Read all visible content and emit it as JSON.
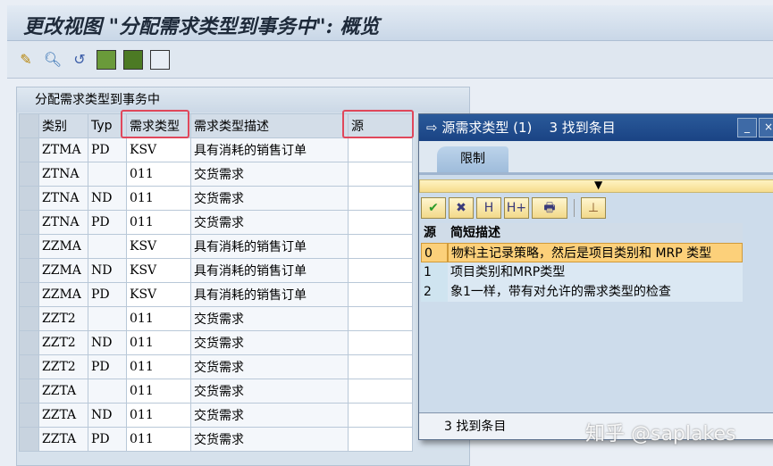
{
  "title": "更改视图 \"分配需求类型到事务中\": 概览",
  "toolbar": {
    "icons": [
      "change-display-icon",
      "find-icon",
      "undo-icon",
      "select-all-icon",
      "select-block-icon",
      "deselect-all-icon"
    ]
  },
  "panel": {
    "title": "分配需求类型到事务中",
    "columns": [
      "类别",
      "Typ",
      "需求类型",
      "需求类型描述",
      "源"
    ],
    "rows": [
      [
        "ZTMA",
        "PD",
        "KSV",
        "具有消耗的销售订单",
        ""
      ],
      [
        "ZTNA",
        "",
        "011",
        "交货需求",
        ""
      ],
      [
        "ZTNA",
        "ND",
        "011",
        "交货需求",
        ""
      ],
      [
        "ZTNA",
        "PD",
        "011",
        "交货需求",
        ""
      ],
      [
        "ZZMA",
        "",
        "KSV",
        "具有消耗的销售订单",
        ""
      ],
      [
        "ZZMA",
        "ND",
        "KSV",
        "具有消耗的销售订单",
        ""
      ],
      [
        "ZZMA",
        "PD",
        "KSV",
        "具有消耗的销售订单",
        ""
      ],
      [
        "ZZT2",
        "",
        "011",
        "交货需求",
        ""
      ],
      [
        "ZZT2",
        "ND",
        "011",
        "交货需求",
        ""
      ],
      [
        "ZZT2",
        "PD",
        "011",
        "交货需求",
        ""
      ],
      [
        "ZZTA",
        "",
        "011",
        "交货需求",
        ""
      ],
      [
        "ZZTA",
        "ND",
        "011",
        "交货需求",
        ""
      ],
      [
        "ZZTA",
        "PD",
        "011",
        "交货需求",
        ""
      ]
    ]
  },
  "popup": {
    "title": "源需求类型 (1)",
    "count": "3 找到条目",
    "tab": "限制",
    "headers": [
      "源",
      "简短描述"
    ],
    "rows": [
      [
        "0",
        "物料主记录策略，然后是项目类别和 MRP 类型"
      ],
      [
        "1",
        "项目类别和MRP类型"
      ],
      [
        "2",
        "象1一样，带有对允许的需求类型的检查"
      ]
    ],
    "status": "3 找到条目"
  },
  "watermark": "知乎 @saplakes"
}
